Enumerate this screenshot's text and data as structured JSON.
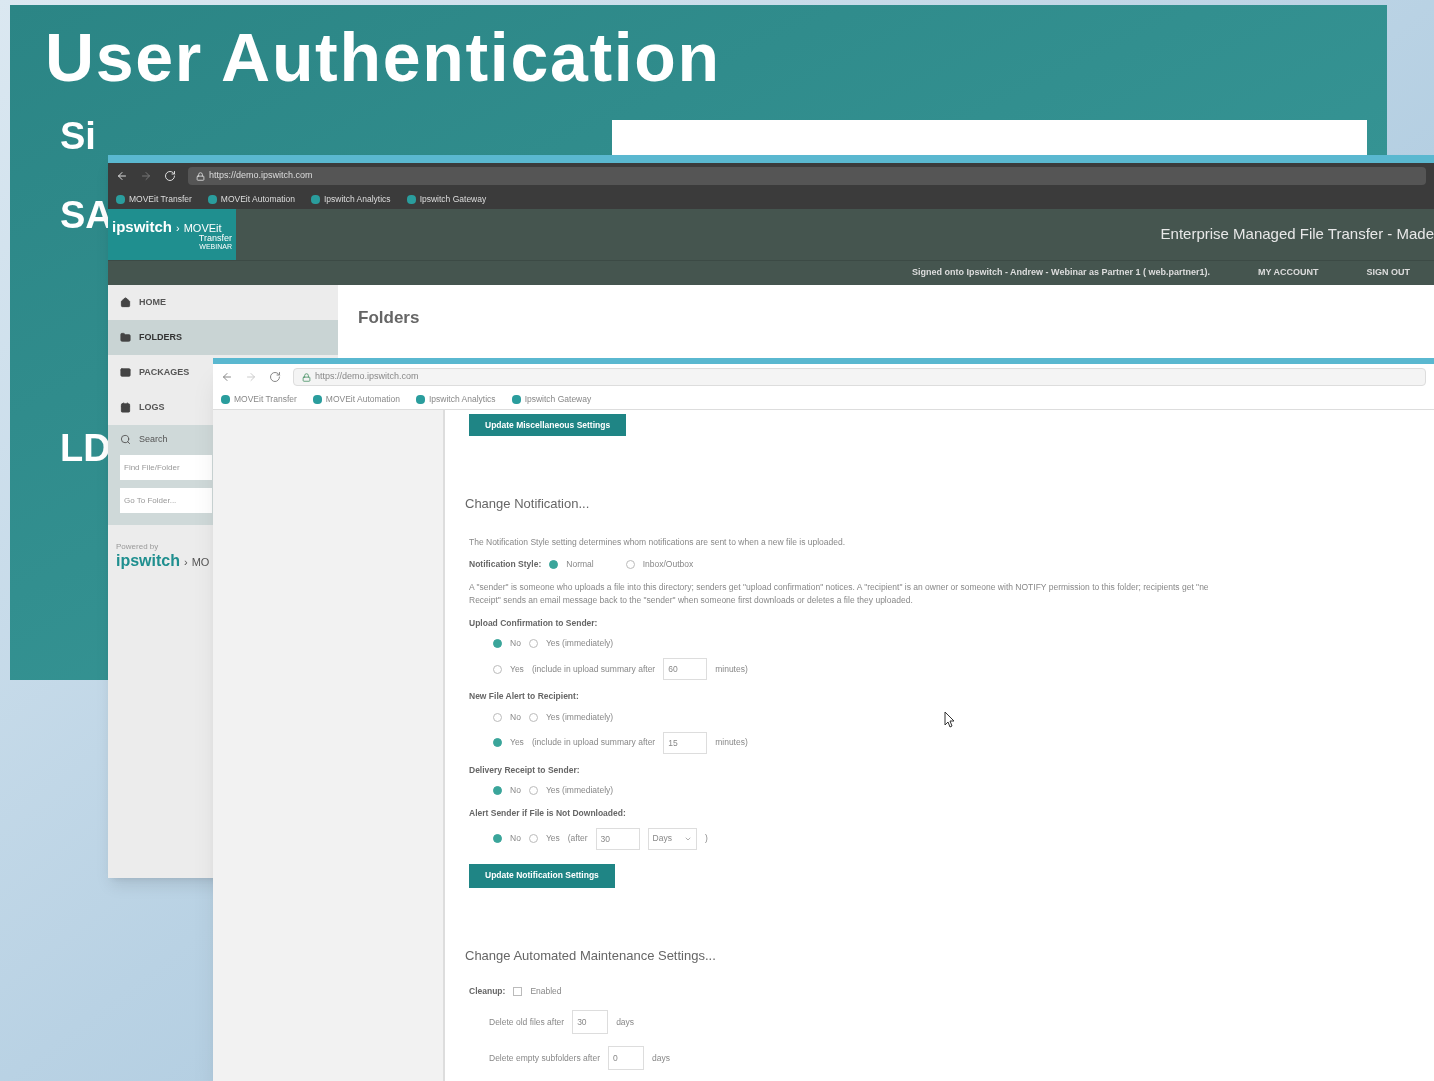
{
  "slide": {
    "title": "User Authentication",
    "bullets": [
      "Si",
      "SA",
      "LD"
    ]
  },
  "back_window": {
    "url": "https://demo.ipswitch.com",
    "bookmarks": [
      "MOVEit Transfer",
      "MOVEit Automation",
      "Ipswitch Analytics",
      "Ipswitch Gateway"
    ],
    "logo": {
      "brand": "ipswitch",
      "separator": "›",
      "product": "MOVEit",
      "sub": "Transfer",
      "edition": "WEBINAR"
    },
    "tagline": "Enterprise Managed File Transfer - Made",
    "signed_in": "Signed onto Ipswitch - Andrew - Webinar as Partner 1 ( web.partner1).",
    "nav_links": [
      "MY ACCOUNT",
      "SIGN OUT"
    ],
    "sidebar": {
      "items": [
        {
          "label": "HOME",
          "selected": false
        },
        {
          "label": "FOLDERS",
          "selected": true
        },
        {
          "label": "PACKAGES",
          "selected": false
        },
        {
          "label": "LOGS",
          "selected": false
        }
      ],
      "search": {
        "label": "Search",
        "fields": [
          {
            "placeholder": "Find File/Folder"
          },
          {
            "placeholder": "Go To Folder..."
          }
        ]
      },
      "powered_by": "Powered by",
      "footer_brand": "ipswitch",
      "footer_separator": "›",
      "footer_product": "MO"
    },
    "page_title": "Folders"
  },
  "front_window": {
    "url": "https://demo.ipswitch.com",
    "bookmarks": [
      "MOVEit Transfer",
      "MOVEit Automation",
      "Ipswitch Analytics",
      "Ipswitch Gateway"
    ],
    "top_button": "Update Miscellaneous Settings",
    "notification": {
      "heading": "Change Notification...",
      "intro": "The Notification Style setting determines whom notifications are sent to when a new file is uploaded.",
      "style": {
        "label": "Notification Style:",
        "options": [
          {
            "label": "Normal",
            "selected": true
          },
          {
            "label": "Inbox/Outbox",
            "selected": false
          }
        ]
      },
      "explanation": "A \"sender\" is someone who uploads a file into this directory; senders get \"upload confirmation\" notices. A \"recipient\" is an owner or someone with NOTIFY permission to this folder; recipients get \"ne",
      "explanation_2": "Receipt\" sends an email message back to the \"sender\" when someone first downloads or deletes a file they uploaded.",
      "settings": [
        {
          "label": "Upload Confirmation to Sender:",
          "rows": [
            [
              {
                "label": "No",
                "selected": true
              },
              {
                "label": "Yes (immediately)",
                "selected": false
              }
            ],
            [
              {
                "label": "Yes",
                "selected": false,
                "note": "(include in upload summary after",
                "value": "60",
                "unit": "minutes)"
              }
            ]
          ]
        },
        {
          "label": "New File Alert to Recipient:",
          "rows": [
            [
              {
                "label": "No",
                "selected": false
              },
              {
                "label": "Yes (immediately)",
                "selected": false
              }
            ],
            [
              {
                "label": "Yes",
                "selected": true,
                "note": "(include in upload summary after",
                "value": "15",
                "unit": "minutes)"
              }
            ]
          ]
        },
        {
          "label": "Delivery Receipt to Sender:",
          "rows": [
            [
              {
                "label": "No",
                "selected": true
              },
              {
                "label": "Yes (immediately)",
                "selected": false
              }
            ]
          ]
        },
        {
          "label": "Alert Sender if File is Not Downloaded:",
          "rows": [
            [
              {
                "label": "No",
                "selected": true
              },
              {
                "label": "Yes",
                "selected": false,
                "note": "(after",
                "value": "30",
                "choice": "Days",
                "unit": ")"
              }
            ]
          ]
        }
      ],
      "button": "Update Notification Settings"
    },
    "maintenance": {
      "heading": "Change Automated Maintenance Settings...",
      "cleanup": {
        "label": "Cleanup:",
        "option": "Enabled",
        "checked": false
      },
      "rows": [
        {
          "label": "Delete old files after",
          "value": "30",
          "unit": "days"
        },
        {
          "label": "Delete empty subfolders after",
          "value": "0",
          "unit": "days"
        }
      ]
    }
  }
}
